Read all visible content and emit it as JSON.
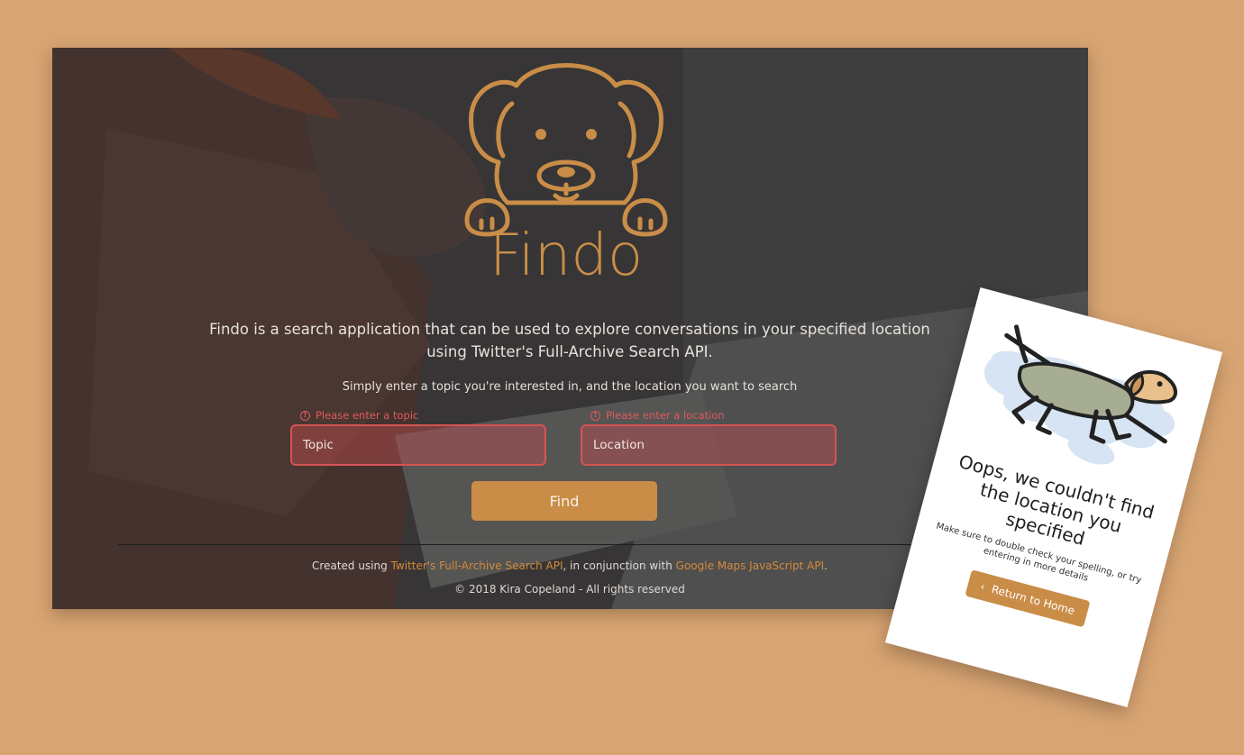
{
  "desktop": {
    "brand": "Findo",
    "intro_line1": "Findo is a search application that can be used to explore conversations in your specified location",
    "intro_line2": "using Twitter's Full-Archive Search API.",
    "instruction": "Simply enter a topic you're interested in, and the location you want to search",
    "topic": {
      "error": "Please enter a topic",
      "placeholder": "Topic",
      "value": ""
    },
    "location": {
      "error": "Please enter a location",
      "placeholder": "Location",
      "value": ""
    },
    "find_label": "Find",
    "footer": {
      "prefix": "Created using ",
      "link1": "Twitter's Full-Archive Search API",
      "middle": ", in conjunction with ",
      "link2": "Google Maps JavaScript API",
      "suffix": ".",
      "copyright": "© 2018 Kira Copeland - All rights reserved"
    }
  },
  "mobile": {
    "heading": "Oops, we couldn't find the location you specified",
    "hint": "Make sure to double check your spelling, or try entering in more details",
    "back_label": "Return to Home"
  },
  "colors": {
    "page_background": "#d8a472",
    "accent": "#c98d48",
    "error": "#d45454"
  },
  "icons": [
    "dog-logo-icon",
    "alert-circle-icon",
    "chevron-left-icon",
    "running-dog-illustration"
  ]
}
